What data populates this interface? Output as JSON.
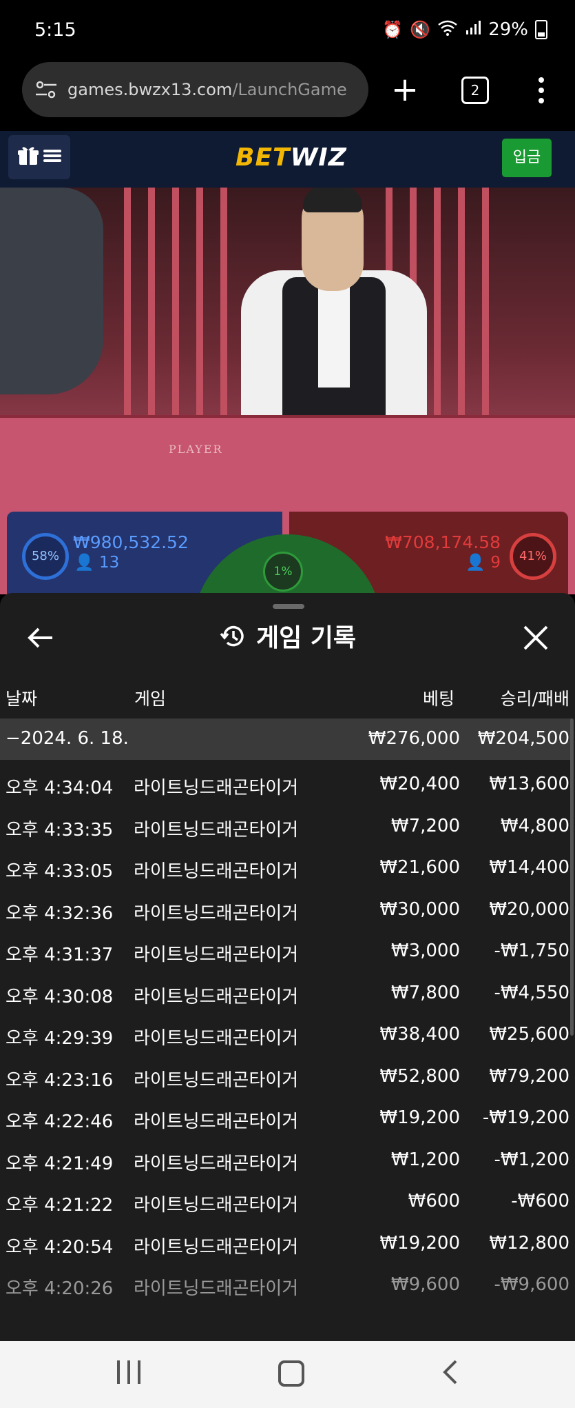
{
  "status_bar": {
    "time": "5:15",
    "battery_percent": "29%",
    "icons": [
      "alarm-icon",
      "mute-icon",
      "wifi-icon",
      "signal-icon",
      "battery-icon"
    ]
  },
  "browser": {
    "url_host": "games.bwzx13.com",
    "url_path": "/LaunchGame",
    "tab_count": "2"
  },
  "site": {
    "logo_bet": "BET",
    "logo_wiz": "WIZ",
    "deposit_label": "입금"
  },
  "video": {
    "table_text": "PLAYER"
  },
  "bets": {
    "player_percent": "58%",
    "player_amount": "₩980,532.52",
    "player_count": "13",
    "tie_percent": "1%",
    "banker_percent": "41%",
    "banker_amount": "₩708,174.58",
    "banker_count": "9"
  },
  "modal": {
    "title": "게임 기록",
    "columns": {
      "date": "날짜",
      "game": "게임",
      "bet": "베팅",
      "result": "승리/패배"
    },
    "date_group": {
      "label": "−2024. 6. 18.",
      "bet_total": "₩276,000",
      "result_total": "₩204,500"
    },
    "rows": [
      {
        "time": "오후 4:34:04",
        "game": "라이트닝드래곤타이거",
        "bet": "₩20,400",
        "result": "₩13,600"
      },
      {
        "time": "오후 4:33:35",
        "game": "라이트닝드래곤타이거",
        "bet": "₩7,200",
        "result": "₩4,800"
      },
      {
        "time": "오후 4:33:05",
        "game": "라이트닝드래곤타이거",
        "bet": "₩21,600",
        "result": "₩14,400"
      },
      {
        "time": "오후 4:32:36",
        "game": "라이트닝드래곤타이거",
        "bet": "₩30,000",
        "result": "₩20,000"
      },
      {
        "time": "오후 4:31:37",
        "game": "라이트닝드래곤타이거",
        "bet": "₩3,000",
        "result": "-₩1,750"
      },
      {
        "time": "오후 4:30:08",
        "game": "라이트닝드래곤타이거",
        "bet": "₩7,800",
        "result": "-₩4,550"
      },
      {
        "time": "오후 4:29:39",
        "game": "라이트닝드래곤타이거",
        "bet": "₩38,400",
        "result": "₩25,600"
      },
      {
        "time": "오후 4:23:16",
        "game": "라이트닝드래곤타이거",
        "bet": "₩52,800",
        "result": "₩79,200"
      },
      {
        "time": "오후 4:22:46",
        "game": "라이트닝드래곤타이거",
        "bet": "₩19,200",
        "result": "-₩19,200"
      },
      {
        "time": "오후 4:21:49",
        "game": "라이트닝드래곤타이거",
        "bet": "₩1,200",
        "result": "-₩1,200"
      },
      {
        "time": "오후 4:21:22",
        "game": "라이트닝드래곤타이거",
        "bet": "₩600",
        "result": "-₩600"
      },
      {
        "time": "오후 4:20:54",
        "game": "라이트닝드래곤타이거",
        "bet": "₩19,200",
        "result": "₩12,800"
      },
      {
        "time": "오후 4:20:26",
        "game": "라이트닝드래곤타이거",
        "bet": "₩9,600",
        "result": "-₩9,600"
      }
    ]
  }
}
